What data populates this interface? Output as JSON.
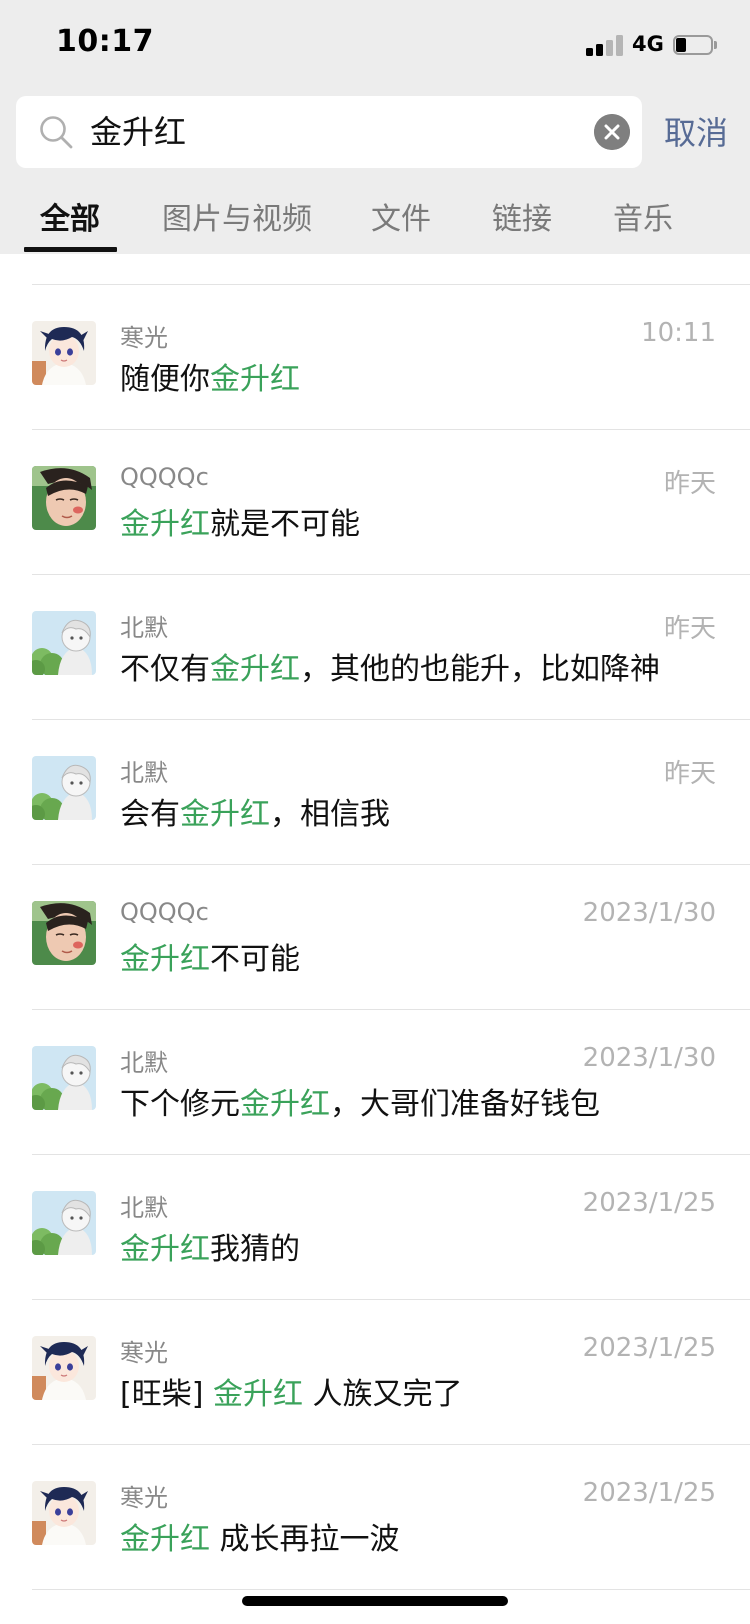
{
  "status_bar": {
    "time": "10:17",
    "network": "4G",
    "signal_bars": 2,
    "battery_level": 0.3
  },
  "search": {
    "query": "金升红",
    "cancel_label": "取消"
  },
  "tabs": [
    {
      "label": "全部",
      "active": true
    },
    {
      "label": "图片与视频",
      "active": false
    },
    {
      "label": "文件",
      "active": false
    },
    {
      "label": "链接",
      "active": false
    },
    {
      "label": "音乐",
      "active": false
    }
  ],
  "colors": {
    "highlight": "#3aa25a",
    "cancel": "#576b95",
    "header_bg": "#ededed"
  },
  "results": [
    {
      "sender": "寒光",
      "date": "10:11",
      "avatar": "avatar-hanguang",
      "pre": "随便你",
      "hl": "金升红",
      "post": ""
    },
    {
      "sender": "QQQQc",
      "date": "昨天",
      "avatar": "avatar-qqqqc",
      "pre": "",
      "hl": "金升红",
      "post": "就是不可能"
    },
    {
      "sender": "北默",
      "date": "昨天",
      "avatar": "avatar-beimo",
      "pre": "不仅有",
      "hl": "金升红",
      "post": "，其他的也能升，比如降神"
    },
    {
      "sender": "北默",
      "date": "昨天",
      "avatar": "avatar-beimo",
      "pre": "会有",
      "hl": "金升红",
      "post": "，相信我"
    },
    {
      "sender": "QQQQc",
      "date": "2023/1/30",
      "avatar": "avatar-qqqqc",
      "pre": "",
      "hl": "金升红",
      "post": "不可能"
    },
    {
      "sender": "北默",
      "date": "2023/1/30",
      "avatar": "avatar-beimo",
      "pre": "下个修元",
      "hl": "金升红",
      "post": "，大哥们准备好钱包"
    },
    {
      "sender": "北默",
      "date": "2023/1/25",
      "avatar": "avatar-beimo",
      "pre": "",
      "hl": "金升红",
      "post": "我猜的"
    },
    {
      "sender": "寒光",
      "date": "2023/1/25",
      "avatar": "avatar-hanguang",
      "pre": "[旺柴] ",
      "hl": "金升红",
      "post": " 人族又完了"
    },
    {
      "sender": "寒光",
      "date": "2023/1/25",
      "avatar": "avatar-hanguang",
      "pre": "",
      "hl": "金升红",
      "post": " 成长再拉一波"
    }
  ]
}
